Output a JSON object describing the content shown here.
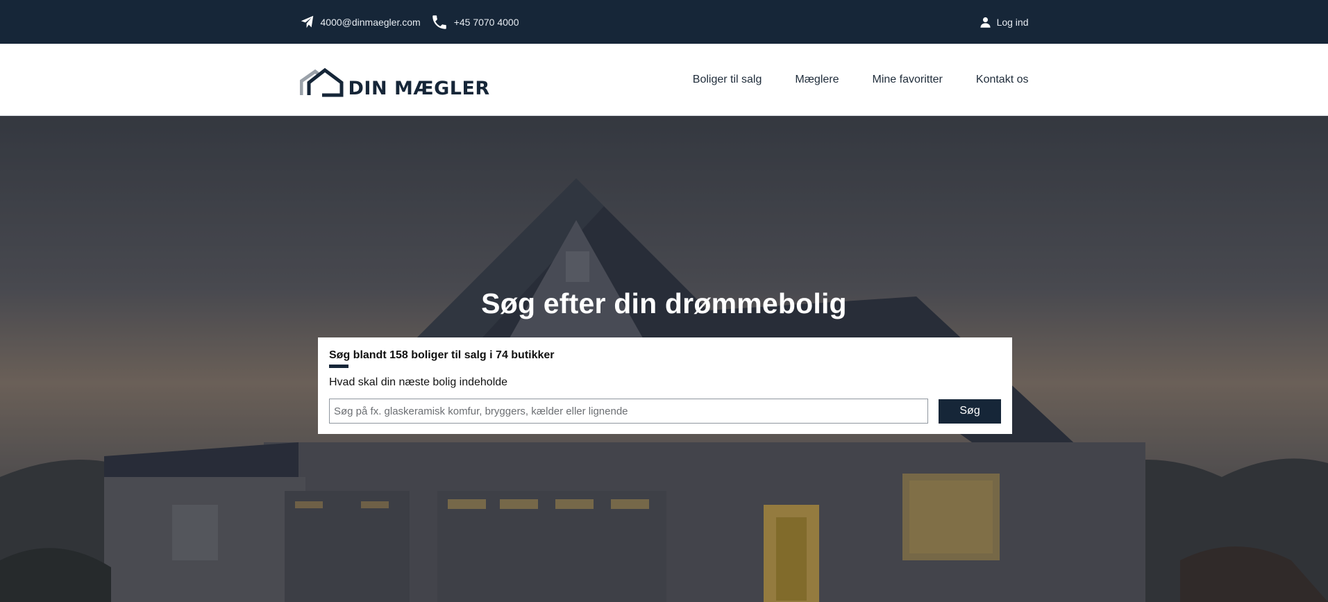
{
  "topbar": {
    "email": "4000@dinmaegler.com",
    "phone": "+45 7070 4000",
    "login_label": "Log ind",
    "icons": {
      "email": "paper-plane-icon",
      "phone": "phone-icon",
      "login": "user-icon"
    }
  },
  "header": {
    "logo_text": "DIN MÆGLER",
    "nav": [
      {
        "label": "Boliger til salg"
      },
      {
        "label": "Mæglere"
      },
      {
        "label": "Mine favoritter"
      },
      {
        "label": "Kontakt os"
      }
    ]
  },
  "hero": {
    "title": "Søg efter din drømmebolig"
  },
  "search": {
    "title": "Søg blandt 158 boliger til salg i 74 butikker",
    "subtitle": "Hvad skal din næste bolig indeholde",
    "placeholder": "Søg på fx. glaskeramisk komfur, bryggers, kælder eller lignende",
    "button_label": "Søg"
  },
  "colors": {
    "primary": "#162638",
    "topbar_bg": "#162638",
    "white": "#ffffff"
  }
}
